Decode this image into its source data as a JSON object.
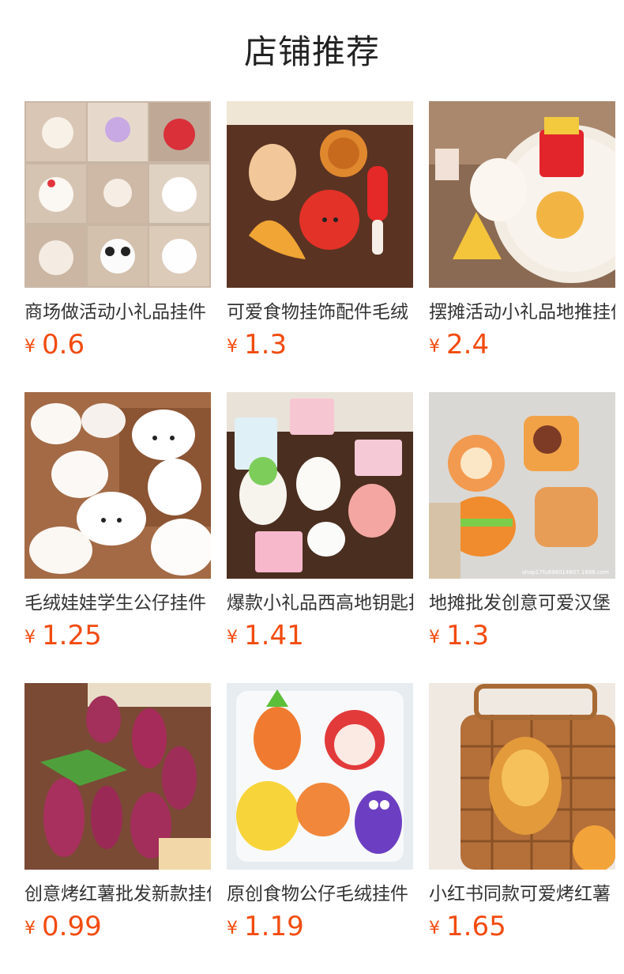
{
  "section_title": "店铺推荐",
  "currency_symbol": "¥",
  "accent_color": "#f24b0f",
  "products": [
    {
      "name": "商场做活动小礼品挂件",
      "price": "0.6"
    },
    {
      "name": "可爱食物挂饰配件毛绒",
      "price": "1.3"
    },
    {
      "name": "摆摊活动小礼品地推挂件",
      "price": "2.4"
    },
    {
      "name": "毛绒娃娃学生公仔挂件",
      "price": "1.25"
    },
    {
      "name": "爆款小礼品西高地钥匙扣",
      "price": "1.41"
    },
    {
      "name": "地摊批发创意可爱汉堡",
      "price": "1.3"
    },
    {
      "name": "创意烤红薯批发新款挂件",
      "price": "0.99"
    },
    {
      "name": "原创食物公仔毛绒挂件",
      "price": "1.19"
    },
    {
      "name": "小红书同款可爱烤红薯",
      "price": "1.65"
    }
  ],
  "watermark_text": "shop17fu898014607.1688.com"
}
